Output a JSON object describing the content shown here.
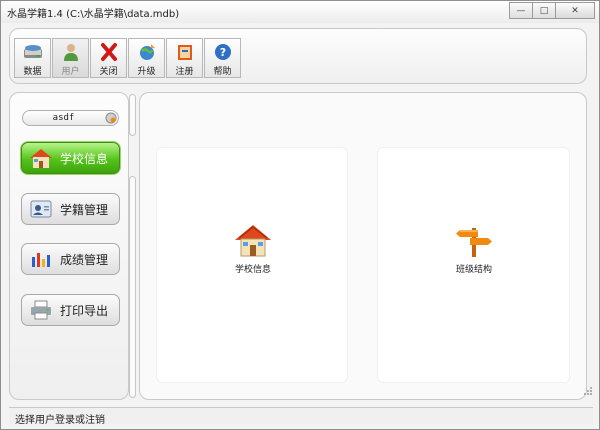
{
  "window": {
    "title": "水晶学籍1.4  (C:\\水晶学籍\\data.mdb)",
    "minimize_glyph": "—",
    "maximize_glyph": "□",
    "close_glyph": "✕"
  },
  "toolbar": {
    "items": [
      {
        "label": "数据",
        "icon": "database-icon",
        "active": false
      },
      {
        "label": "用户",
        "icon": "user-icon",
        "active": true
      },
      {
        "label": "关闭",
        "icon": "close-x-icon",
        "active": false
      },
      {
        "label": "升级",
        "icon": "upgrade-globe-icon",
        "active": false
      },
      {
        "label": "注册",
        "icon": "register-book-icon",
        "active": false
      },
      {
        "label": "帮助",
        "icon": "help-icon",
        "active": false
      }
    ]
  },
  "sidebar": {
    "user_value": "asdf",
    "items": [
      {
        "label": "学校信息",
        "icon": "school-house-icon",
        "selected": true
      },
      {
        "label": "学籍管理",
        "icon": "student-card-icon",
        "selected": false
      },
      {
        "label": "成绩管理",
        "icon": "grades-chart-icon",
        "selected": false
      },
      {
        "label": "打印导出",
        "icon": "printer-icon",
        "selected": false
      }
    ]
  },
  "main": {
    "cards": [
      {
        "label": "学校信息",
        "icon": "school-house-icon"
      },
      {
        "label": "班级结构",
        "icon": "signpost-icon"
      }
    ]
  },
  "status": {
    "text": "选择用户登录或注销"
  },
  "colors": {
    "selected_green": "#55c31a",
    "house_roof": "#e0471a",
    "signpost_orange": "#f08a12"
  }
}
